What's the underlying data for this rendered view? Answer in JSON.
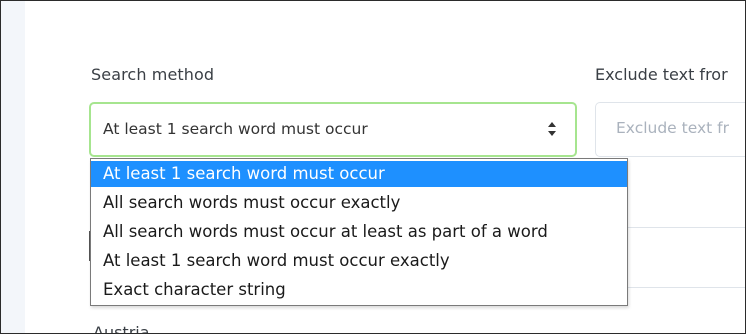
{
  "form": {
    "search_method_label": "Search method",
    "exclude_label": "Exclude text fror",
    "selected_value": "At least 1 search word must occur",
    "exclude_placeholder": "Exclude text fr",
    "country_label": "Austria"
  },
  "dropdown": {
    "options": [
      "At least 1 search word must occur",
      "All search words must occur exactly",
      "All search words must occur at least as part of a word",
      "At least 1 search word must occur exactly",
      "Exact character string"
    ],
    "selected_index": 0
  },
  "colors": {
    "focus_border": "#a6e58f",
    "selected_bg": "#1e90ff",
    "placeholder": "#aab2bd"
  },
  "icons": {
    "select_arrows": "sort-updown-icon"
  }
}
